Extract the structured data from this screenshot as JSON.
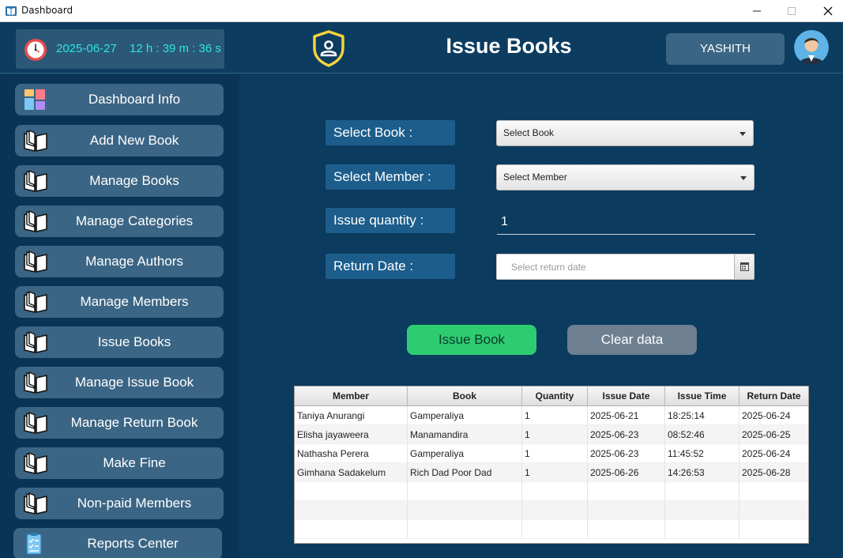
{
  "window": {
    "title": "Dashboard"
  },
  "header": {
    "date": "2025-06-27",
    "time": "12 h : 39 m : 36 s",
    "title": "Issue Books",
    "user": "YASHITH"
  },
  "sidebar": {
    "items": [
      {
        "label": "Dashboard Info",
        "icon": "dashboard-icon"
      },
      {
        "label": "Add New Book",
        "icon": "book-icon"
      },
      {
        "label": "Manage Books",
        "icon": "book-icon"
      },
      {
        "label": "Manage Categories",
        "icon": "book-icon"
      },
      {
        "label": "Manage Authors",
        "icon": "book-icon"
      },
      {
        "label": "Manage Members",
        "icon": "book-icon"
      },
      {
        "label": "Issue Books",
        "icon": "book-icon"
      },
      {
        "label": "Manage Issue Book",
        "icon": "book-icon"
      },
      {
        "label": "Manage Return Book",
        "icon": "book-icon"
      },
      {
        "label": "Make Fine",
        "icon": "book-icon"
      },
      {
        "label": "Non-paid Members",
        "icon": "book-icon"
      },
      {
        "label": "Reports Center",
        "icon": "clipboard-icon"
      }
    ]
  },
  "form": {
    "book_label": "Select Book :",
    "book_value": "Select Book",
    "member_label": "Select Member :",
    "member_value": "Select Member",
    "qty_label": "Issue quantity :",
    "qty_value": "1",
    "return_label": "Return Date :",
    "return_placeholder": "Select return date",
    "issue_button": "Issue Book",
    "clear_button": "Clear data"
  },
  "table": {
    "columns": [
      "Member",
      "Book",
      "Quantity",
      "Issue Date",
      "Issue Time",
      "Return Date"
    ],
    "rows": [
      [
        "Taniya Anurangi",
        "Gamperaliya",
        "1",
        "2025-06-21",
        "18:25:14",
        "2025-06-24"
      ],
      [
        "Elisha jayaweera",
        "Manamandira",
        "1",
        "2025-06-23",
        "08:52:46",
        "2025-06-25"
      ],
      [
        "Nathasha Perera",
        "Gamperaliya",
        "1",
        "2025-06-23",
        "11:45:52",
        "2025-06-24"
      ],
      [
        "Gimhana Sadakelum",
        "Rich Dad Poor Dad",
        "1",
        "2025-06-26",
        "14:26:53",
        "2025-06-28"
      ]
    ]
  },
  "colors": {
    "background": "#0b3b5e",
    "accent_cyan": "#2ee3e3",
    "button": "#3b6584",
    "issue_green": "#2ecc71",
    "clear_gray": "#6d7f90"
  }
}
